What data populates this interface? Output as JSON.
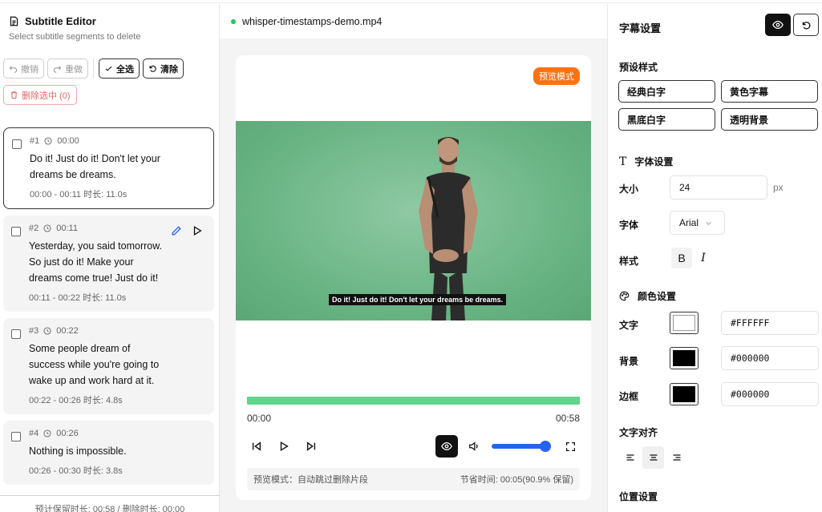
{
  "left": {
    "title": "Subtitle Editor",
    "subtitle": "Select subtitle segments to delete",
    "toolbar": {
      "undo": "撤销",
      "redo": "重做",
      "select_all": "全选",
      "clear": "清除",
      "delete_selected": "删除选中 (0)"
    },
    "segments": [
      {
        "num": "#1",
        "start": "00:00",
        "text": "Do it! Just do it! Don't let your dreams be dreams.",
        "meta": "00:00 - 00:11   时长: 11.0s",
        "selected": true
      },
      {
        "num": "#2",
        "start": "00:11",
        "text": "Yesterday, you said tomorrow. So just do it! Make your dreams come true! Just do it!",
        "meta": "00:11 - 00:22   时长: 11.0s",
        "selected": false
      },
      {
        "num": "#3",
        "start": "00:22",
        "text": "Some people dream of success while you're going to wake up and work hard at it.",
        "meta": "00:22 - 00:26   时长: 4.8s",
        "selected": false
      },
      {
        "num": "#4",
        "start": "00:26",
        "text": "Nothing is impossible.",
        "meta": "00:26 - 00:30   时长: 3.8s",
        "selected": false
      }
    ],
    "footer": "预计保留时长: 00:58 / 删除时长: 00:00"
  },
  "center": {
    "filename": "whisper-timestamps-demo.mp4",
    "badge": "预览模式",
    "caption": "Do it! Just do it! Don't let your dreams be dreams.",
    "progress": 1.0,
    "time_current": "00:00",
    "time_total": "00:58",
    "volume": 0.9,
    "info_left": "预览模式：自动跳过删除片段",
    "info_right": "节省时间: 00:05(90.9% 保留)"
  },
  "right": {
    "title": "字幕设置",
    "presets_title": "预设样式",
    "presets": [
      "经典白字",
      "黄色字幕",
      "黑底白字",
      "透明背景"
    ],
    "font_title": "字体设置",
    "size_label": "大小",
    "size_value": "24",
    "size_unit": "px",
    "font_label": "字体",
    "font_value": "Arial",
    "style_label": "样式",
    "bold": "B",
    "italic": "I",
    "color_title": "颜色设置",
    "text_color_label": "文字",
    "text_color": "#FFFFFF",
    "bg_color_label": "背景",
    "bg_color": "#000000",
    "border_color_label": "边框",
    "border_color": "#000000",
    "align_title": "文字对齐",
    "position_title": "位置设置"
  },
  "colors": {
    "accent": "#2563eb",
    "progress": "#5fd68c",
    "badge": "#f97316",
    "danger": "#e06868",
    "dot": "#22c55e"
  }
}
